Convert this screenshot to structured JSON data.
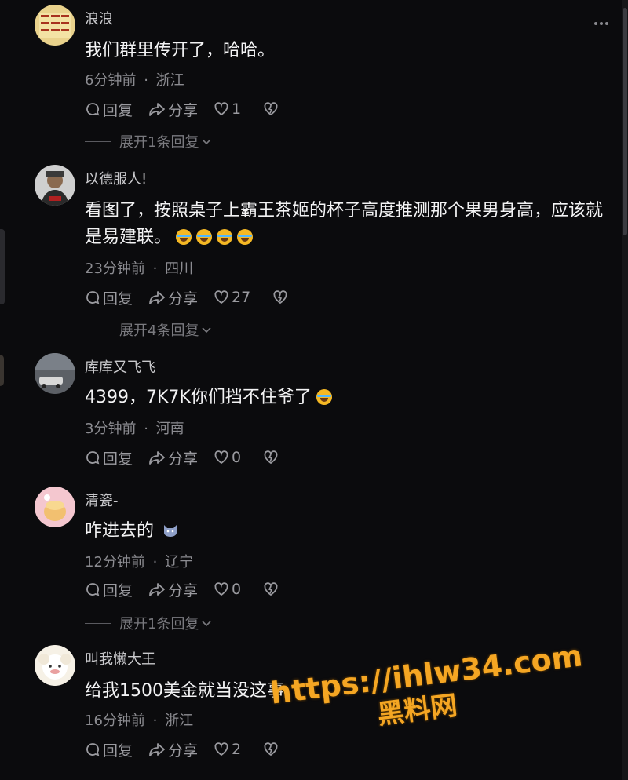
{
  "comments": [
    {
      "username": "浪浪",
      "content": "我们群里传开了，哈哈。",
      "time": "6分钟前",
      "location": "浙江",
      "reply_label": "回复",
      "share_label": "分享",
      "likes": "1",
      "expand": "展开1条回复"
    },
    {
      "username": "以德服人!",
      "content": "看图了，按照桌子上霸王茶姬的杯子高度推测那个果男身高，应该就是易建联。",
      "time": "23分钟前",
      "location": "四川",
      "reply_label": "回复",
      "share_label": "分享",
      "likes": "27",
      "expand": "展开4条回复"
    },
    {
      "username": "库库又飞飞",
      "content": "4399，7K7K你们挡不住爷了",
      "time": "3分钟前",
      "location": "河南",
      "reply_label": "回复",
      "share_label": "分享",
      "likes": "0"
    },
    {
      "username": "清瓷-",
      "content": "咋进去的",
      "time": "12分钟前",
      "location": "辽宁",
      "reply_label": "回复",
      "share_label": "分享",
      "likes": "0",
      "expand": "展开1条回复"
    },
    {
      "username": "叫我懒大王",
      "content": "给我1500美金就当没这事",
      "time": "16分钟前",
      "location": "浙江",
      "reply_label": "回复",
      "share_label": "分享",
      "likes": "2"
    }
  ],
  "meta_separator": "·",
  "watermark": {
    "url": "https://ihlw34.com",
    "name": "黑料网"
  },
  "icons": {
    "reply": "reply-bubble-icon",
    "share": "share-arrow-icon",
    "like": "heart-icon",
    "dislike": "broken-heart-icon",
    "expand": "chevron-down-icon",
    "more": "more-dots-icon"
  },
  "colors": {
    "background": "#0b0b0d",
    "text_primary": "#f3f3f4",
    "text_secondary": "#8c8c91",
    "watermark": "#f5a623"
  }
}
